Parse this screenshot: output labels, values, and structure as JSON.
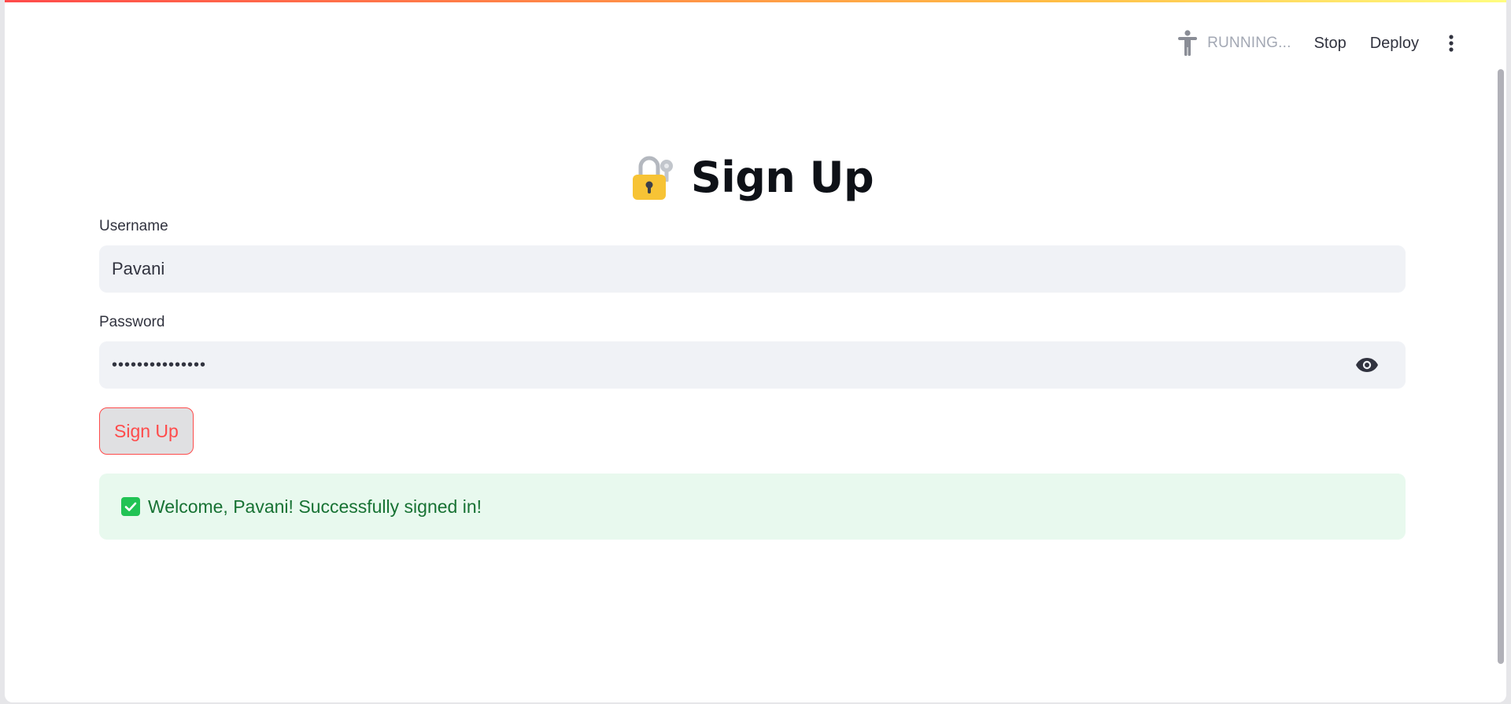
{
  "header": {
    "status_icon": "running-person-icon",
    "status_text": "RUNNING...",
    "stop_label": "Stop",
    "deploy_label": "Deploy",
    "menu_icon": "kebab-menu-icon"
  },
  "page": {
    "title_icon": "locked-with-key-emoji",
    "title": "Sign Up"
  },
  "form": {
    "username_label": "Username",
    "username_value": "Pavani",
    "password_label": "Password",
    "password_value": "•••••••••••••••",
    "password_toggle_icon": "eye-icon",
    "submit_label": "Sign Up"
  },
  "alert": {
    "icon": "check-box-icon",
    "message": "Welcome, Pavani! Successfully signed in!"
  },
  "colors": {
    "accent": "#ff4b4b",
    "input_bg": "#f0f2f6",
    "success_bg": "#e8f9ee",
    "success_text": "#177233",
    "success_icon": "#21c354"
  }
}
